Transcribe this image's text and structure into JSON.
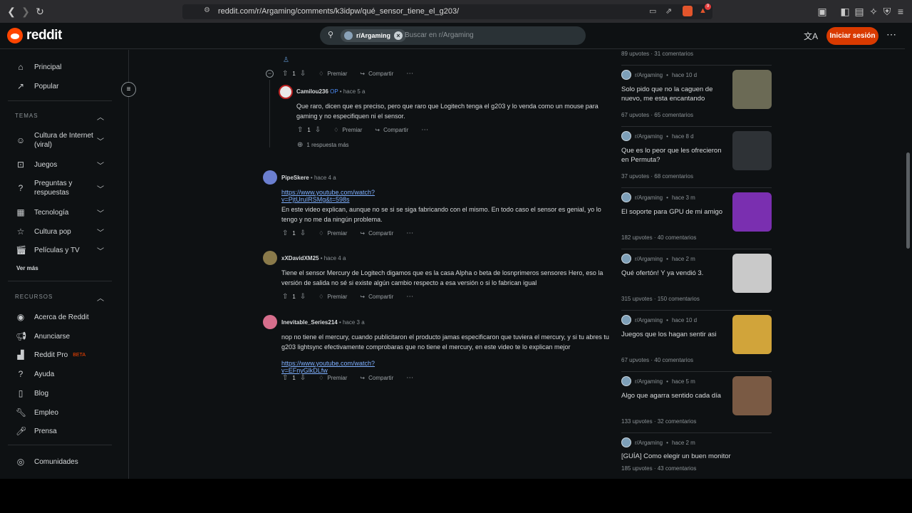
{
  "browser": {
    "url": "reddit.com/r/Argaming/comments/k3idpw/qué_sensor_tiene_el_g203/",
    "badge_count": "9"
  },
  "header": {
    "logo_text": "reddit",
    "subreddit_chip": "r/Argaming",
    "search_placeholder": "Buscar en r/Argaming",
    "login_label": "Iniciar sesión"
  },
  "sidebar": {
    "nav": [
      {
        "label": "Principal",
        "icon": "home-icon"
      },
      {
        "label": "Popular",
        "icon": "popular-icon"
      }
    ],
    "topics_title": "TEMAS",
    "topics": [
      {
        "label": "Cultura de Internet (viral)",
        "icon": "smiley-icon"
      },
      {
        "label": "Juegos",
        "icon": "gamepad-icon"
      },
      {
        "label": "Preguntas y respuestas",
        "icon": "question-icon"
      },
      {
        "label": "Tecnología",
        "icon": "chip-icon"
      },
      {
        "label": "Cultura pop",
        "icon": "star-icon"
      },
      {
        "label": "Películas y TV",
        "icon": "clapper-icon"
      }
    ],
    "see_more": "Ver más",
    "resources_title": "RECURSOS",
    "resources": [
      {
        "label": "Acerca de Reddit",
        "icon": "reddit-icon"
      },
      {
        "label": "Anunciarse",
        "icon": "megaphone-icon"
      },
      {
        "label": "Reddit Pro",
        "icon": "pro-icon",
        "badge": "BETA"
      },
      {
        "label": "Ayuda",
        "icon": "help-icon"
      },
      {
        "label": "Blog",
        "icon": "book-icon"
      },
      {
        "label": "Empleo",
        "icon": "wrench-icon"
      },
      {
        "label": "Prensa",
        "icon": "mic-icon"
      }
    ],
    "communities": "Comunidades"
  },
  "actions": {
    "award": "Premiar",
    "share": "Compartir"
  },
  "top_comment_actions": {
    "votes": "1"
  },
  "comments": [
    {
      "user": "Camilou236",
      "op": "OP",
      "time": "hace 5 a",
      "text": "Que raro, dicen que es preciso, pero que raro que Logitech tenga el g203 y lo venda como un mouse para gaming y no especifiquen ni el sensor.",
      "votes": "1",
      "more_replies": "1 respuesta más"
    },
    {
      "user": "PipeSkere",
      "time": "hace 4 a",
      "link": "https://www.youtube.com/watch?v=PjtUruIRSMg&t=598s",
      "text": "En este video explican, aunque no se si se siga fabricando con el mismo. En todo caso el sensor es genial, yo lo tengo y no me da ningún problema.",
      "votes": "1"
    },
    {
      "user": "xXDavidXM25",
      "time": "hace 4 a",
      "text": "Tiene el sensor Mercury de Logitech digamos que es la casa Alpha o beta de losnprimeros sensores Hero, eso la versión de salida no sé si existe algún cambio respecto a esa versión o si lo fabrican igual",
      "votes": "1"
    },
    {
      "user": "Inevitable_Series214",
      "time": "hace 3 a",
      "text": "nop no tiene el mercury, cuando publicitaron el producto jamas especificaron que tuviera el mercury, y si tu abres tu g203 lightsync efectivamente comprobaras que no tiene el mercury, en este video te lo explican mejor",
      "link": "https://www.youtube.com/watch?v=EFnyGlkDLfw",
      "votes": "1"
    }
  ],
  "related": {
    "first_stats": "89 upvotes · 31 comentarios",
    "posts": [
      {
        "sub": "r/Argaming",
        "time": "hace 10 d",
        "title": "Solo pido que no la caguen de nuevo, me esta encantando",
        "stats": "67 upvotes · 65 comentarios",
        "thumb_color": "#6b6a55"
      },
      {
        "sub": "r/Argaming",
        "time": "hace 8 d",
        "title": "Que es lo peor que les ofrecieron en Permuta?",
        "stats": "37 upvotes · 68 comentarios",
        "thumb_color": "#2e3236"
      },
      {
        "sub": "r/Argaming",
        "time": "hace 3 m",
        "title": "El soporte para GPU de mi amigo",
        "stats": "182 upvotes · 40 comentarios",
        "thumb_color": "#7a2fb0"
      },
      {
        "sub": "r/Argaming",
        "time": "hace 2 m",
        "title": "Qué ofertón! Y ya vendió 3.",
        "stats": "315 upvotes · 150 comentarios",
        "thumb_color": "#c9c9c9"
      },
      {
        "sub": "r/Argaming",
        "time": "hace 10 d",
        "title": "Juegos que los hagan sentir asi",
        "stats": "67 upvotes · 40 comentarios",
        "thumb_color": "#d1a43a"
      },
      {
        "sub": "r/Argaming",
        "time": "hace 5 m",
        "title": "Algo que agarra sentido cada día",
        "stats": "133 upvotes · 32 comentarios",
        "thumb_color": "#7a5a44"
      },
      {
        "sub": "r/Argaming",
        "time": "hace 2 m",
        "title": "[GUÍA] Como elegir un buen monitor",
        "stats": "185 upvotes · 43 comentarios"
      }
    ]
  }
}
